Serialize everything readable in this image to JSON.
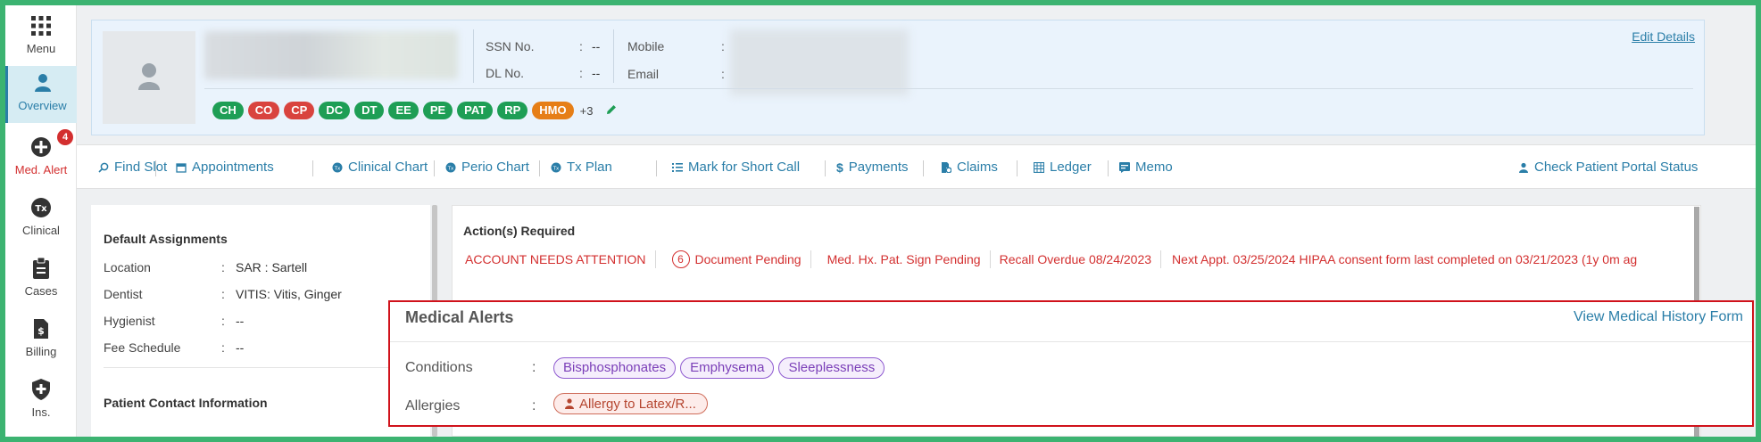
{
  "sidebar": {
    "items": [
      {
        "label": "Menu",
        "icon": "grid-icon"
      },
      {
        "label": "Overview",
        "icon": "user-icon"
      },
      {
        "label": "Med. Alert",
        "icon": "plus-circle-icon",
        "badge": "4"
      },
      {
        "label": "Clinical",
        "icon": "tx-icon"
      },
      {
        "label": "Cases",
        "icon": "clipboard-icon"
      },
      {
        "label": "Billing",
        "icon": "document-dollar-icon"
      },
      {
        "label": "Ins.",
        "icon": "shield-plus-icon"
      }
    ]
  },
  "patient": {
    "ssn_label": "SSN No.",
    "ssn_value": "--",
    "dl_label": "DL No.",
    "dl_value": "--",
    "mobile_label": "Mobile",
    "email_label": "Email",
    "colon": ":",
    "edit_label": "Edit Details",
    "tags": [
      {
        "code": "CH",
        "color": "#1e9e55"
      },
      {
        "code": "CO",
        "color": "#d9433e"
      },
      {
        "code": "CP",
        "color": "#d9433e"
      },
      {
        "code": "DC",
        "color": "#1e9e55"
      },
      {
        "code": "DT",
        "color": "#1e9e55"
      },
      {
        "code": "EE",
        "color": "#1e9e55"
      },
      {
        "code": "PE",
        "color": "#1e9e55"
      },
      {
        "code": "PAT",
        "color": "#1e9e55"
      },
      {
        "code": "RP",
        "color": "#1e9e55"
      },
      {
        "code": "HMO",
        "color": "#e67e16"
      }
    ],
    "tags_more": "+3"
  },
  "toolbar": {
    "items": [
      {
        "label": "Find Slot",
        "icon": "search-icon"
      },
      {
        "label": "Appointments",
        "icon": "calendar-icon"
      },
      {
        "label": "Clinical Chart",
        "icon": "tx-icon"
      },
      {
        "label": "Perio Chart",
        "icon": "tx-icon"
      },
      {
        "label": "Tx Plan",
        "icon": "tx-icon"
      },
      {
        "label": "Mark for Short Call",
        "icon": "list-icon"
      },
      {
        "label": "Payments",
        "icon": "dollar-icon"
      },
      {
        "label": "Claims",
        "icon": "claims-icon"
      },
      {
        "label": "Ledger",
        "icon": "table-icon"
      },
      {
        "label": "Memo",
        "icon": "memo-icon"
      }
    ],
    "portal_label": "Check Patient Portal Status"
  },
  "assignments": {
    "title": "Default Assignments",
    "rows": [
      {
        "label": "Location",
        "value": "SAR : Sartell"
      },
      {
        "label": "Dentist",
        "value": "VITIS: Vitis, Ginger"
      },
      {
        "label": "Hygienist",
        "value": "--"
      },
      {
        "label": "Fee Schedule",
        "value": "--"
      }
    ],
    "contact_title": "Patient Contact Information"
  },
  "actions": {
    "title": "Action(s) Required",
    "items": [
      {
        "text": "ACCOUNT NEEDS ATTENTION"
      },
      {
        "count": "6",
        "text": "Document Pending"
      },
      {
        "text": "Med. Hx. Pat. Sign Pending"
      },
      {
        "text": "Recall Overdue 08/24/2023"
      },
      {
        "text": "Next Appt. 03/25/2024 HIPAA consent form last completed on 03/21/2023 (1y 0m ag"
      }
    ]
  },
  "medical_alerts": {
    "title": "Medical Alerts",
    "link": "View Medical History Form",
    "conditions_label": "Conditions",
    "conditions": [
      "Bisphosphonates",
      "Emphysema",
      "Sleeplessness"
    ],
    "allergies_label": "Allergies",
    "allergies": [
      "Allergy to Latex/R..."
    ],
    "border_color": "#d0121b"
  }
}
